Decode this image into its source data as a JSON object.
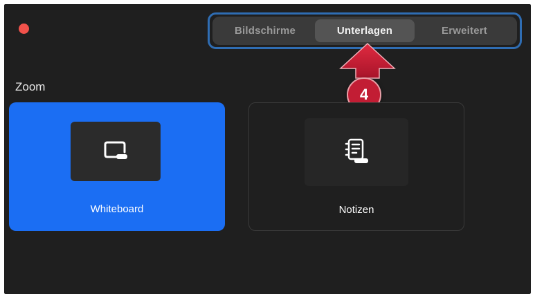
{
  "tabs": [
    {
      "label": "Bildschirme",
      "active": false
    },
    {
      "label": "Unterlagen",
      "active": true
    },
    {
      "label": "Erweitert",
      "active": false
    }
  ],
  "callout": {
    "number": "4",
    "color": "#c21d34"
  },
  "section": {
    "title": "Zoom"
  },
  "cards": [
    {
      "label": "Whiteboard",
      "icon": "whiteboard-icon",
      "selected": true
    },
    {
      "label": "Notizen",
      "icon": "notes-icon",
      "selected": false
    }
  ],
  "colors": {
    "accent": "#1b6ef3",
    "highlight_border": "#2f6db3",
    "close_dot": "#f2524b"
  }
}
